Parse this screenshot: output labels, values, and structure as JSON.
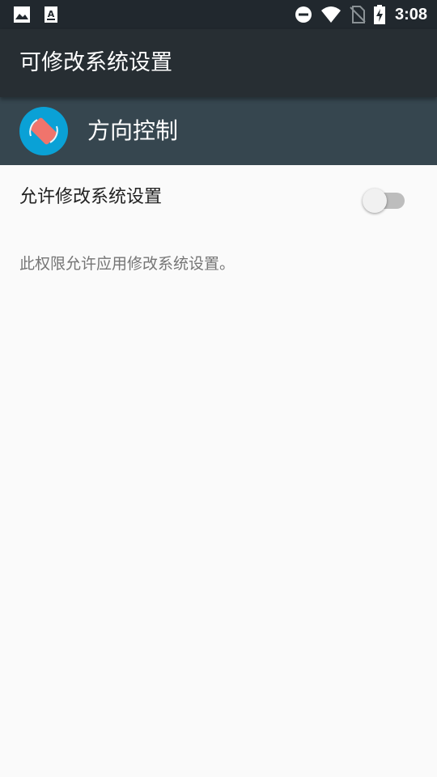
{
  "status_bar": {
    "time": "3:08",
    "icons": [
      "image-notification-icon",
      "font-notification-icon",
      "do-not-disturb-icon",
      "wifi-icon",
      "no-sim-icon",
      "battery-charging-icon"
    ]
  },
  "app_bar": {
    "title": "可修改系统设置"
  },
  "app_header": {
    "app_name": "方向控制",
    "icon": "screen-rotation-app-icon"
  },
  "setting": {
    "label": "允许修改系统设置",
    "enabled": false
  },
  "description": "此权限允许应用修改系统设置。",
  "colors": {
    "status_bar": "#21282e",
    "app_bar": "#272e33",
    "app_header": "#36464f",
    "background": "#fafafa",
    "app_icon_bg": "#0aa1d6",
    "app_icon_accent": "#f0746c"
  }
}
